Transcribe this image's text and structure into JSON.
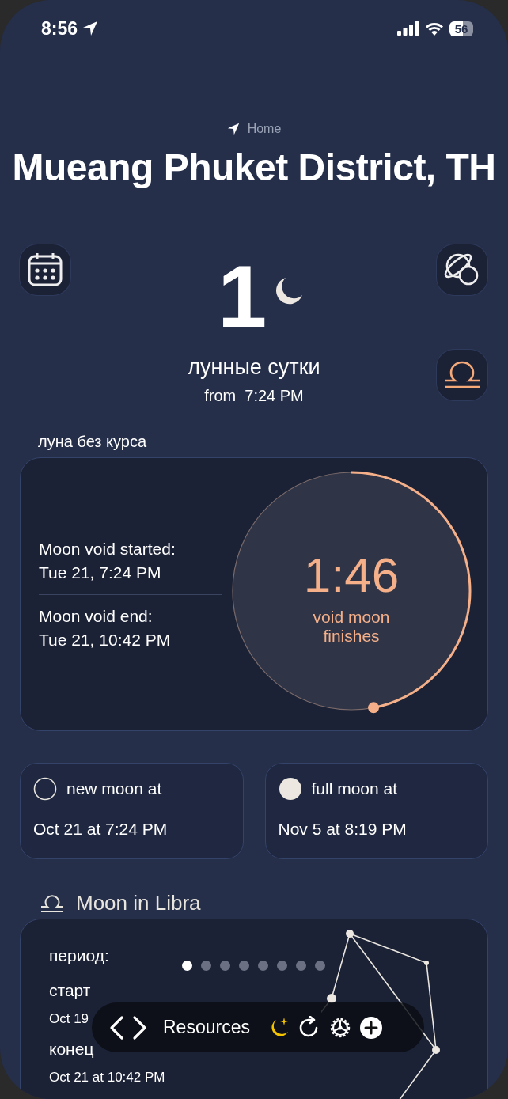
{
  "status_bar": {
    "time": "8:56",
    "battery": "56"
  },
  "location": {
    "label": "Home",
    "title": "Mueang Phuket District, TH"
  },
  "lunar_day": {
    "number": "1",
    "name": "лунные сутки",
    "from_label": "from",
    "from_time": "7:24 PM"
  },
  "void_section": {
    "heading": "луна без курса",
    "started_label": "Moon void started:",
    "started_value": "Tue 21, 7:24 PM",
    "end_label": "Moon void end:",
    "end_value": "Tue 21, 10:42 PM",
    "countdown": "1:46",
    "countdown_caption": "void moon finishes"
  },
  "phases": [
    {
      "kind": "new",
      "label": "new moon at",
      "date": "Oct 21 at 7:24 PM"
    },
    {
      "kind": "full",
      "label": "full moon at",
      "date": "Nov 5 at 8:19 PM"
    }
  ],
  "sign_section": {
    "title": "Moon in Libra",
    "period_label": "период:",
    "start_label": "старт",
    "start_value": "Oct 19",
    "end_label": "конец",
    "end_value": "Oct 21 at 10:42 PM"
  },
  "page_dots": [
    {
      "selected": true
    },
    {
      "selected": false
    },
    {
      "selected": false
    },
    {
      "selected": false
    },
    {
      "selected": false
    },
    {
      "selected": false
    },
    {
      "selected": false
    },
    {
      "selected": false
    }
  ],
  "toolbar": {
    "label": "Resources"
  }
}
